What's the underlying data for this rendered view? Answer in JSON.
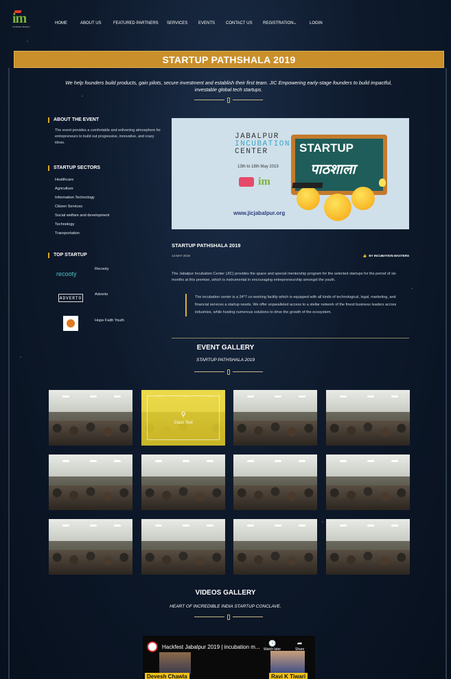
{
  "nav": {
    "logo_text": "im",
    "logo_sub": "Incubation Masters",
    "items": [
      "HOME",
      "ABOUT US",
      "FEATURED PARTNERS",
      "SERVICES",
      "EVENTS",
      "CONTACT US",
      "REGISTRATION",
      "LOGIN"
    ]
  },
  "banner": {
    "title": "STARTUP PATHSHALA 2019"
  },
  "tagline": "We help founders build products, gain pilots, secure investment and establish their first team. JIC Empowering early-stage founders to build impactful, investable global tech startups.",
  "about": {
    "heading": "ABOUT THE EVENT",
    "text": "The event provides a comfortable and enlivening atmosphere for entrepreneurs to build out progressive, innovative, and crazy ideas."
  },
  "sectors": {
    "heading": "STARTUP SECTORS",
    "items": [
      "Healthcare",
      "Agriculture",
      "Information Technology",
      "Citizen Services",
      "Social welfare and development",
      "Technology",
      "Transportation"
    ]
  },
  "top_startup": {
    "heading": "TOP STARTUP",
    "items": [
      {
        "logo": "recooty",
        "name": "Recooty"
      },
      {
        "logo": "ADVERTO",
        "name": "Adverto"
      },
      {
        "logo": "",
        "name": "Hope Faith Youth"
      }
    ]
  },
  "poster": {
    "line1": "JABALPUR",
    "line2": "INCUBATION",
    "line3": "CENTER",
    "date": "13th to 18th May 2019",
    "board_title": "STARTUP",
    "board_sub": "पाठशाला",
    "url": "www.jicjabalpur.org"
  },
  "post": {
    "title": "STARTUP PATHSHALA 2019",
    "date": "13 MAY 2019",
    "by": "BY INCUBATION MASTERS",
    "paragraph": "The Jabalpur Incubation Center (JIC) provides the space and special mentorship program for the selected startups for the period of six months at this premise, which is instrumental in encouraging entrepreneurship amongst the youth.",
    "quote": "The incubation center is a 24*7 co-working facility which is equipped with all kinds of technological, legal, marketing, and financial services a startup needs. We offer unparalleled access to a stellar network of the finest business leaders across industries, while hosting numerous solutions to drive the growth of the ecosystem."
  },
  "gallery": {
    "title": "EVENT GALLERY",
    "subtitle": "STARTUP PATHSHALA 2019",
    "hover_caption": "Class Test",
    "image_count": 12
  },
  "videos": {
    "title": "VIDEOS GALLERY",
    "subtitle": "HEART OF INCREDIBLE INDIA STARTUP CONCLAVE.",
    "video_title": "Hackfest Jabalpur 2019 | incubation m...",
    "watch_later": "Watch later",
    "share": "Share",
    "name_left": "Devesh Chawla",
    "name_right": "Ravi K Tiwari"
  },
  "colors": {
    "accent": "#c98f2a",
    "bg": "#0e1a2c",
    "highlight": "#e0a622"
  }
}
